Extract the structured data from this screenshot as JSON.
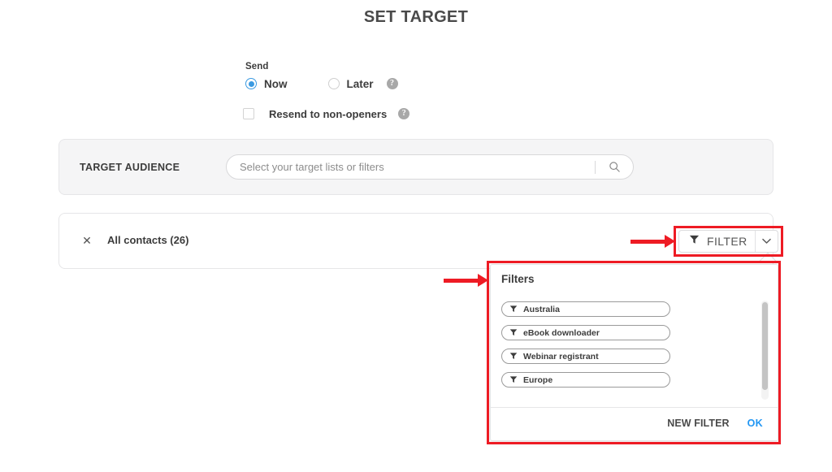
{
  "page": {
    "title": "SET TARGET"
  },
  "send": {
    "label": "Send",
    "options": [
      {
        "label": "Now",
        "selected": true
      },
      {
        "label": "Later",
        "selected": false
      }
    ],
    "help_icon": "help-circle-icon",
    "help_glyph": "?"
  },
  "resend": {
    "label": "Resend to non-openers",
    "checked": false,
    "help_icon": "help-circle-icon",
    "help_glyph": "?"
  },
  "target_audience": {
    "label": "TARGET AUDIENCE",
    "search": {
      "value": "",
      "placeholder": "Select your target lists or filters",
      "icon": "search-icon"
    }
  },
  "contacts": {
    "remove_icon": "close-x-icon",
    "remove_glyph": "✕",
    "name": "All contacts (26)"
  },
  "filter_button": {
    "label": "FILTER",
    "icon": "funnel-icon",
    "caret_icon": "chevron-down-icon"
  },
  "filters_popup": {
    "title": "Filters",
    "items": [
      {
        "label": "Australia",
        "icon": "funnel-icon"
      },
      {
        "label": "eBook downloader",
        "icon": "funnel-icon"
      },
      {
        "label": "Webinar registrant",
        "icon": "funnel-icon"
      },
      {
        "label": "Europe",
        "icon": "funnel-icon"
      }
    ],
    "new_filter_label": "NEW FILTER",
    "ok_label": "OK"
  },
  "annotations": {
    "color": "#ee1b24",
    "arrows": [
      {
        "name": "arrow-to-filter-button"
      },
      {
        "name": "arrow-to-filters-popup"
      }
    ],
    "boxes": [
      {
        "name": "highlight-filter-button"
      },
      {
        "name": "highlight-filters-popup"
      }
    ]
  },
  "colors": {
    "accent_blue": "#3b9ae1",
    "ok_blue": "#2196f3",
    "annotation_red": "#ee1b24",
    "card_gray": "#f5f5f6",
    "text_dark": "#3c3c3c"
  }
}
